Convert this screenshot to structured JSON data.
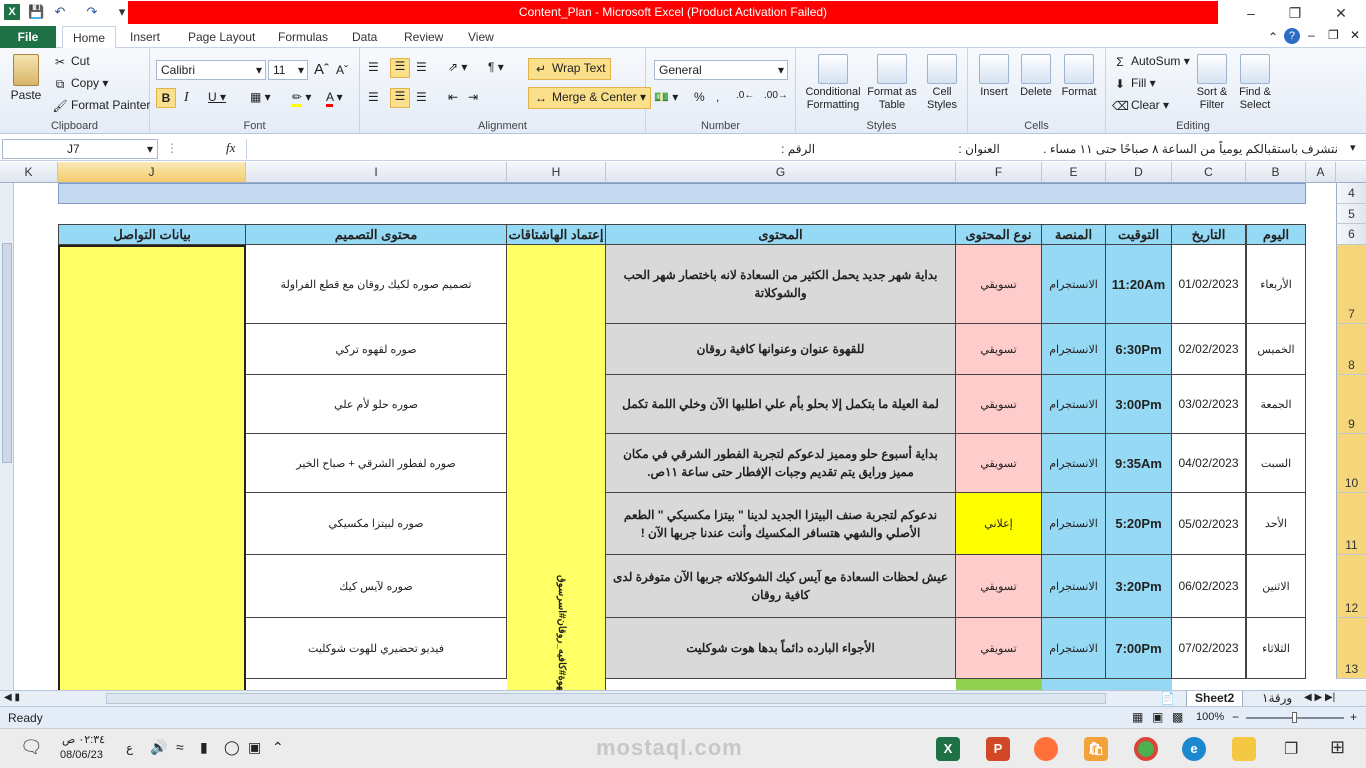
{
  "window": {
    "title": "Content_Plan  -  Microsoft Excel (Product Activation Failed)"
  },
  "tabs": [
    "File",
    "Home",
    "Insert",
    "Page Layout",
    "Formulas",
    "Data",
    "Review",
    "View"
  ],
  "ribbon": {
    "clipboard": {
      "paste": "Paste",
      "cut": "Cut",
      "copy": "Copy",
      "format_painter": "Format Painter",
      "label": "Clipboard"
    },
    "font": {
      "name": "Calibri",
      "size": "11",
      "label": "Font"
    },
    "alignment": {
      "wrap_text": "Wrap Text",
      "merge_center": "Merge & Center",
      "label": "Alignment"
    },
    "number": {
      "format": "General",
      "label": "Number"
    },
    "styles": {
      "conditional": "Conditional Formatting",
      "format_table": "Format as Table",
      "cell_styles": "Cell Styles",
      "label": "Styles"
    },
    "cells": {
      "insert": "Insert",
      "delete": "Delete",
      "format": "Format",
      "label": "Cells"
    },
    "editing": {
      "autosum": "AutoSum",
      "fill": "Fill",
      "clear": "Clear",
      "sort_filter": "Sort & Filter",
      "find_select": "Find & Select",
      "label": "Editing"
    }
  },
  "formula_bar": {
    "name_box": "J7",
    "fx": "fx",
    "formula": "نتشرف باستقبالكم يومياً من الساعة ٨ صباحًا حتى ١١ مساء .             العنوان :                                           الرقم :"
  },
  "columns": [
    "K",
    "J",
    "I",
    "H",
    "G",
    "F",
    "E",
    "D",
    "C",
    "B",
    "A"
  ],
  "table": {
    "headers": {
      "day": "اليوم",
      "date": "التاريخ",
      "time": "التوقيت",
      "platform": "المنصة",
      "type": "نوع المحتوى",
      "content": "المحتوى",
      "hashtags": "إعتماد الهاشتاقات",
      "design": "محتوى التصميم",
      "contact": "بيانات التواصل"
    },
    "hashtag_text": "قهوة#كافيه_روقان#اسرسوق",
    "rows": [
      {
        "row": "7",
        "day": "الأربعاء",
        "date": "01/02/2023",
        "time": "11:20Am",
        "platform": "الانستجرام",
        "type": "تسويقي",
        "content": "بداية شهر جديد يحمل الكثير من السعادة لانه باختصار شهر الحب والشوكلاتة",
        "design": "تصميم صوره لكيك روقان مع قطع الفراولة"
      },
      {
        "row": "8",
        "day": "الخميس",
        "date": "02/02/2023",
        "time": "6:30Pm",
        "platform": "الانستجرام",
        "type": "تسويقي",
        "content": "للقهوة عنوان وعنوانها كافية روقان",
        "design": "صوره لقهوه تركي"
      },
      {
        "row": "9",
        "day": "الجمعة",
        "date": "03/02/2023",
        "time": "3:00Pm",
        "platform": "الانستجرام",
        "type": "تسويقي",
        "content": "لمة العيلة ما بتكمل إلا بحلو بأم علي اطلبها الآن وخلي اللمة تكمل",
        "design": "صوره حلو لأم علي"
      },
      {
        "row": "10",
        "day": "السبت",
        "date": "04/02/2023",
        "time": "9:35Am",
        "platform": "الانستجرام",
        "type": "تسويقي",
        "content": "بداية أسبوع حلو ومميز لدعوكم لتجربة الفطور الشرقي في مكان مميز ورايق يتم تقديم وجبات الإفطار حتى ساعة ١١ص.",
        "design": "صوره لفطور الشرقي + صباح الخير"
      },
      {
        "row": "11",
        "day": "الأحد",
        "date": "05/02/2023",
        "time": "5:20Pm",
        "platform": "الانستجرام",
        "type": "إعلاني",
        "content": "ندعوكم لتجربة صنف البيتزا الجديد لدينا \" بيتزا مكسيكي \" الطعم الأصلي والشهي هتسافر المكسيك وأنت عندنا جربها الآن !",
        "design": "صوره لبيتزا مكسيكي"
      },
      {
        "row": "12",
        "day": "الاثنين",
        "date": "06/02/2023",
        "time": "3:20Pm",
        "platform": "الانستجرام",
        "type": "تسويقي",
        "content": "عيش لحظات السعادة مع آيس كيك الشوكلاته جربها الآن متوفرة لدى كافية روقان",
        "design": "صوره لآيس كيك"
      },
      {
        "row": "13",
        "day": "الثلاثاء",
        "date": "07/02/2023",
        "time": "7:00Pm",
        "platform": "الانستجرام",
        "type": "تسويقي",
        "content": "الأجواء البارده دائماً بدها هوت شوكليت",
        "design": "فيديو تحضيري للهوت شوكليت"
      }
    ]
  },
  "row_numbers_top": [
    "4",
    "5",
    "6"
  ],
  "sheet_tabs": {
    "sheet2": "Sheet2",
    "sheet1": "ورقة١"
  },
  "status": {
    "ready": "Ready",
    "zoom": "100%"
  },
  "taskbar": {
    "time": "٠٢:٣٤ ص",
    "date": "08/06/23",
    "lang": "ع"
  },
  "watermark": "mostaql.com"
}
